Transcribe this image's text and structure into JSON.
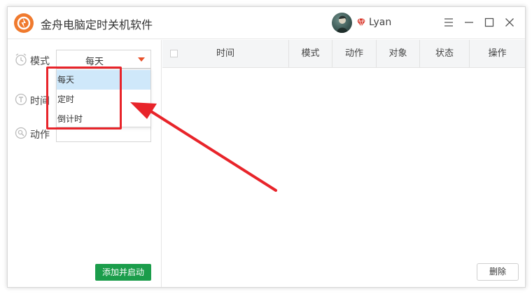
{
  "app": {
    "title": "金舟电脑定时关机软件",
    "logo_icon": "power-logo-icon",
    "accent_color": "#f07a2e"
  },
  "user": {
    "name": "Lyan",
    "vip_icon": "diamond-icon",
    "vip_color": "#d9362a"
  },
  "window_controls": [
    "menu-icon",
    "minimize-icon",
    "maximize-icon",
    "close-icon"
  ],
  "sidebar": {
    "mode": {
      "label": "模式",
      "icon": "clock-icon",
      "value": "每天",
      "options": [
        "每天",
        "定时",
        "倒计时"
      ],
      "highlighted_option": "每天"
    },
    "time": {
      "label": "时间",
      "icon": "timer-icon"
    },
    "action": {
      "label": "动作",
      "icon": "action-icon"
    },
    "add_button_label": "添加并启动",
    "add_button_color": "#1b9d4b"
  },
  "table": {
    "columns": [
      "时间",
      "模式",
      "动作",
      "对象",
      "状态",
      "操作"
    ],
    "rows": []
  },
  "delete_button_label": "删除",
  "annotation": {
    "color": "#e8242a"
  }
}
